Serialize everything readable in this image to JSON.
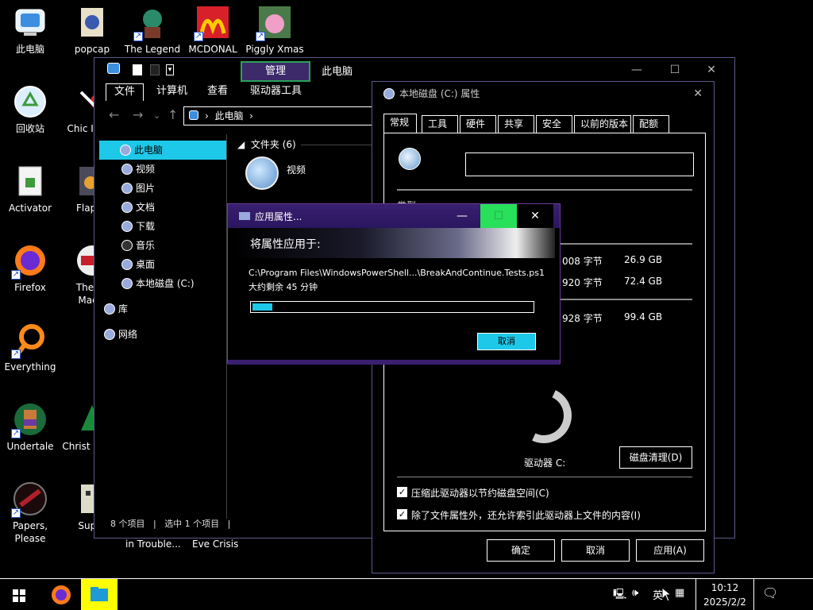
{
  "desktop": {
    "icons": [
      {
        "label": "此电脑"
      },
      {
        "label": "popcap"
      },
      {
        "label": "The Legend"
      },
      {
        "label": "MCDONAL"
      },
      {
        "label": "Piggly Xmas"
      },
      {
        "label": "回收站"
      },
      {
        "label": "Chic Invad"
      },
      {
        "label": "Activator"
      },
      {
        "label": "Flappy"
      },
      {
        "label": "Firefox"
      },
      {
        "label": "The Po Machi"
      },
      {
        "label": "Everything"
      },
      {
        "label": "Undertale"
      },
      {
        "label": "Christ Brows"
      },
      {
        "label": "Papers, Please"
      },
      {
        "label": "Super"
      }
    ],
    "bottom_labels": [
      "in Trouble...",
      "Eve Crisis"
    ]
  },
  "explorer": {
    "manage_tab": "管理",
    "title": "此电脑",
    "ribbon_tabs": [
      "文件",
      "计算机",
      "查看",
      "驱动器工具"
    ],
    "address": "此电脑",
    "sidebar": [
      {
        "label": "此电脑"
      },
      {
        "label": "视频"
      },
      {
        "label": "图片"
      },
      {
        "label": "文档"
      },
      {
        "label": "下载"
      },
      {
        "label": "音乐"
      },
      {
        "label": "桌面"
      },
      {
        "label": "本地磁盘 (C:)"
      },
      {
        "label": "库"
      },
      {
        "label": "网络"
      }
    ],
    "folders_header": "文件夹 (6)",
    "folder_item": "视频",
    "status_count": "8 个项目",
    "status_selected": "选中 1 个项目"
  },
  "props": {
    "title": "本地磁盘 (C:) 属性",
    "tabs": [
      "常规",
      "工具",
      "硬件",
      "共享",
      "安全",
      "以前的版本",
      "配额"
    ],
    "type_label": "类型:",
    "sizes": [
      {
        "bytes": "008 字节",
        "gb": "26.9 GB"
      },
      {
        "bytes": "920 字节",
        "gb": "72.4 GB"
      },
      {
        "bytes": "928 字节",
        "gb": "99.4 GB"
      }
    ],
    "drive_label": "驱动器 C:",
    "cleanup_button": "磁盘清理(D)",
    "compress_label": "压缩此驱动器以节约磁盘空间(C)",
    "index_label": "除了文件属性外，还允许索引此驱动器上文件的内容(I)",
    "ok": "确定",
    "cancel": "取消",
    "apply": "应用(A)"
  },
  "apply_dialog": {
    "title": "应用属性...",
    "heading": "将属性应用于:",
    "path": "C:\\Program Files\\WindowsPowerShell...\\BreakAndContinue.Tests.ps1",
    "remaining": "大约剩余 45 分钟",
    "progress": 0.07,
    "cancel": "取消"
  },
  "taskbar": {
    "time": "10:12",
    "date": "2025/2/2",
    "ime": "英"
  }
}
